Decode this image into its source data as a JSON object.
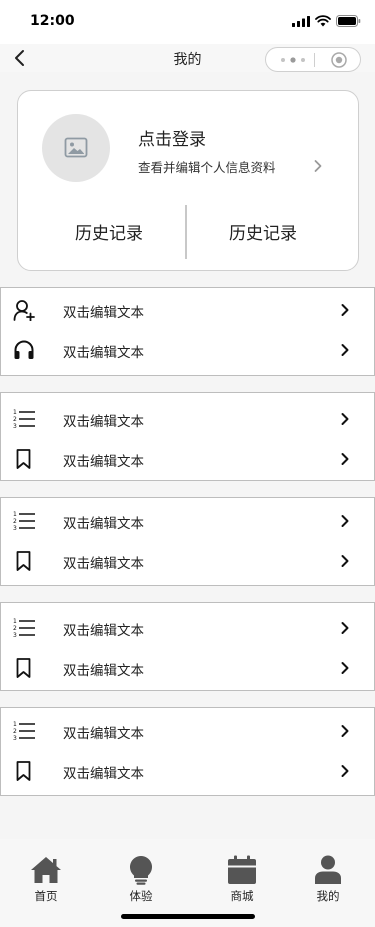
{
  "status_bar": {
    "time": "12:00"
  },
  "nav": {
    "title": "我的"
  },
  "profile": {
    "login_title": "点击登录",
    "login_subtitle": "查看并编辑个人信息资料",
    "history_left": "历史记录",
    "history_right": "历史记录"
  },
  "menu_groups": [
    {
      "items": [
        {
          "icon": "add-user-icon",
          "label": "双击编辑文本"
        },
        {
          "icon": "headphones-icon",
          "label": "双击编辑文本"
        }
      ]
    },
    {
      "items": [
        {
          "icon": "numbered-list-icon",
          "label": "双击编辑文本"
        },
        {
          "icon": "bookmark-icon",
          "label": "双击编辑文本"
        }
      ]
    },
    {
      "items": [
        {
          "icon": "numbered-list-icon",
          "label": "双击编辑文本"
        },
        {
          "icon": "bookmark-icon",
          "label": "双击编辑文本"
        }
      ]
    },
    {
      "items": [
        {
          "icon": "numbered-list-icon",
          "label": "双击编辑文本"
        },
        {
          "icon": "bookmark-icon",
          "label": "双击编辑文本"
        }
      ]
    },
    {
      "items": [
        {
          "icon": "numbered-list-icon",
          "label": "双击编辑文本"
        },
        {
          "icon": "bookmark-icon",
          "label": "双击编辑文本"
        }
      ]
    }
  ],
  "tab_bar": {
    "tabs": [
      {
        "icon": "home-icon",
        "label": "首页"
      },
      {
        "icon": "lightbulb-icon",
        "label": "体验"
      },
      {
        "icon": "calendar-icon",
        "label": "商城"
      },
      {
        "icon": "person-icon",
        "label": "我的"
      }
    ]
  }
}
